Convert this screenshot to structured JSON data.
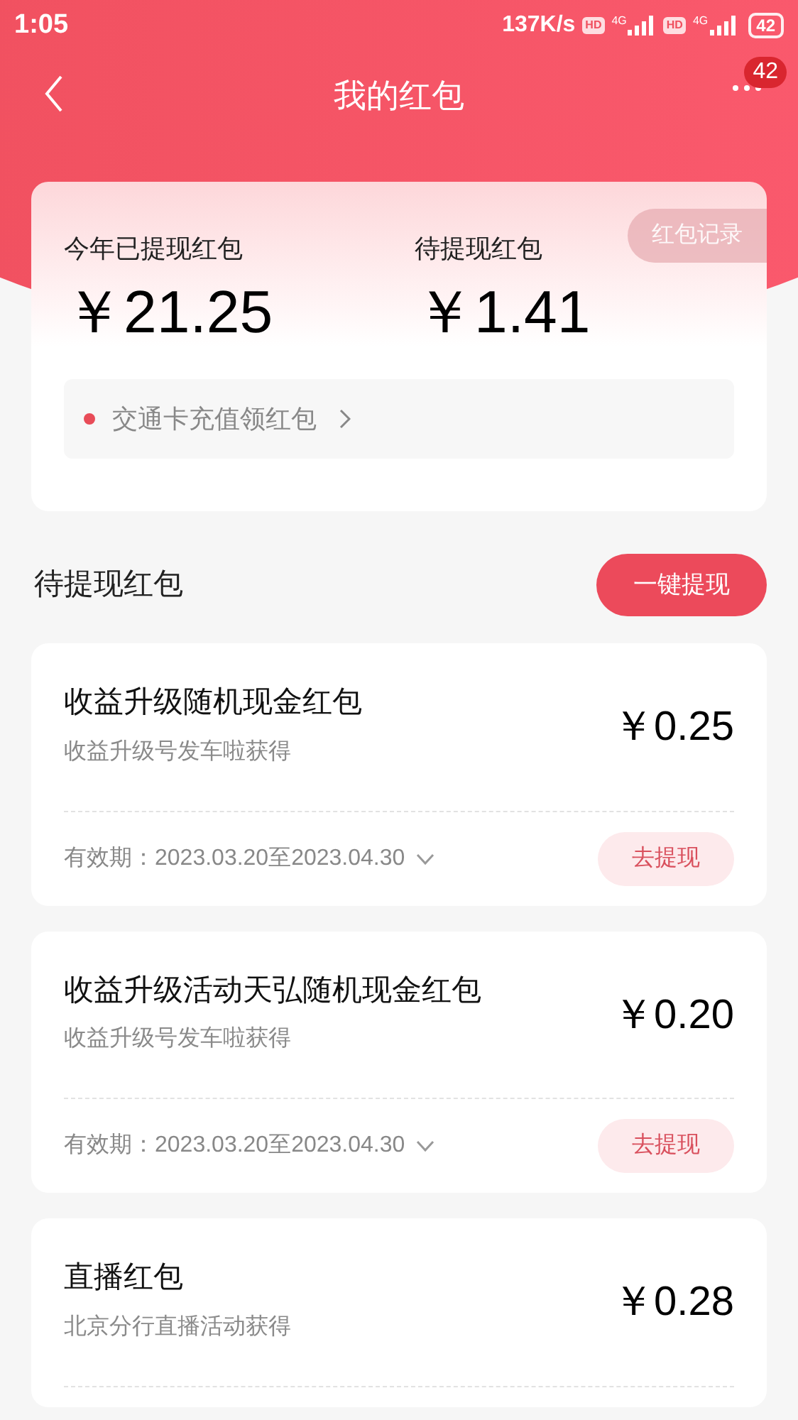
{
  "status_bar": {
    "time": "1:05",
    "speed": "137K/s",
    "sims": [
      {
        "hd": "HD",
        "network": "4G"
      },
      {
        "hd": "HD",
        "network": "4G"
      }
    ],
    "battery": "42"
  },
  "nav": {
    "title": "我的红包",
    "badge": "42"
  },
  "summary": {
    "withdrawn_label": "今年已提现红包",
    "withdrawn_amount": "￥21.25",
    "pending_label": "待提现红包",
    "pending_amount": "￥1.41",
    "records_button": "红包记录",
    "promo": "交通卡充值领红包"
  },
  "section": {
    "title": "待提现红包",
    "action": "一键提现"
  },
  "packets": [
    {
      "title": "收益升级随机现金红包",
      "source": "收益升级号发车啦获得",
      "amount": "￥0.25",
      "validity": "有效期：2023.03.20至2023.04.30",
      "button": "去提现"
    },
    {
      "title": "收益升级活动天弘随机现金红包",
      "source": "收益升级号发车啦获得",
      "amount": "￥0.20",
      "validity": "有效期：2023.03.20至2023.04.30",
      "button": "去提现"
    },
    {
      "title": "直播红包",
      "source": "北京分行直播活动获得",
      "amount": "￥0.28"
    }
  ]
}
